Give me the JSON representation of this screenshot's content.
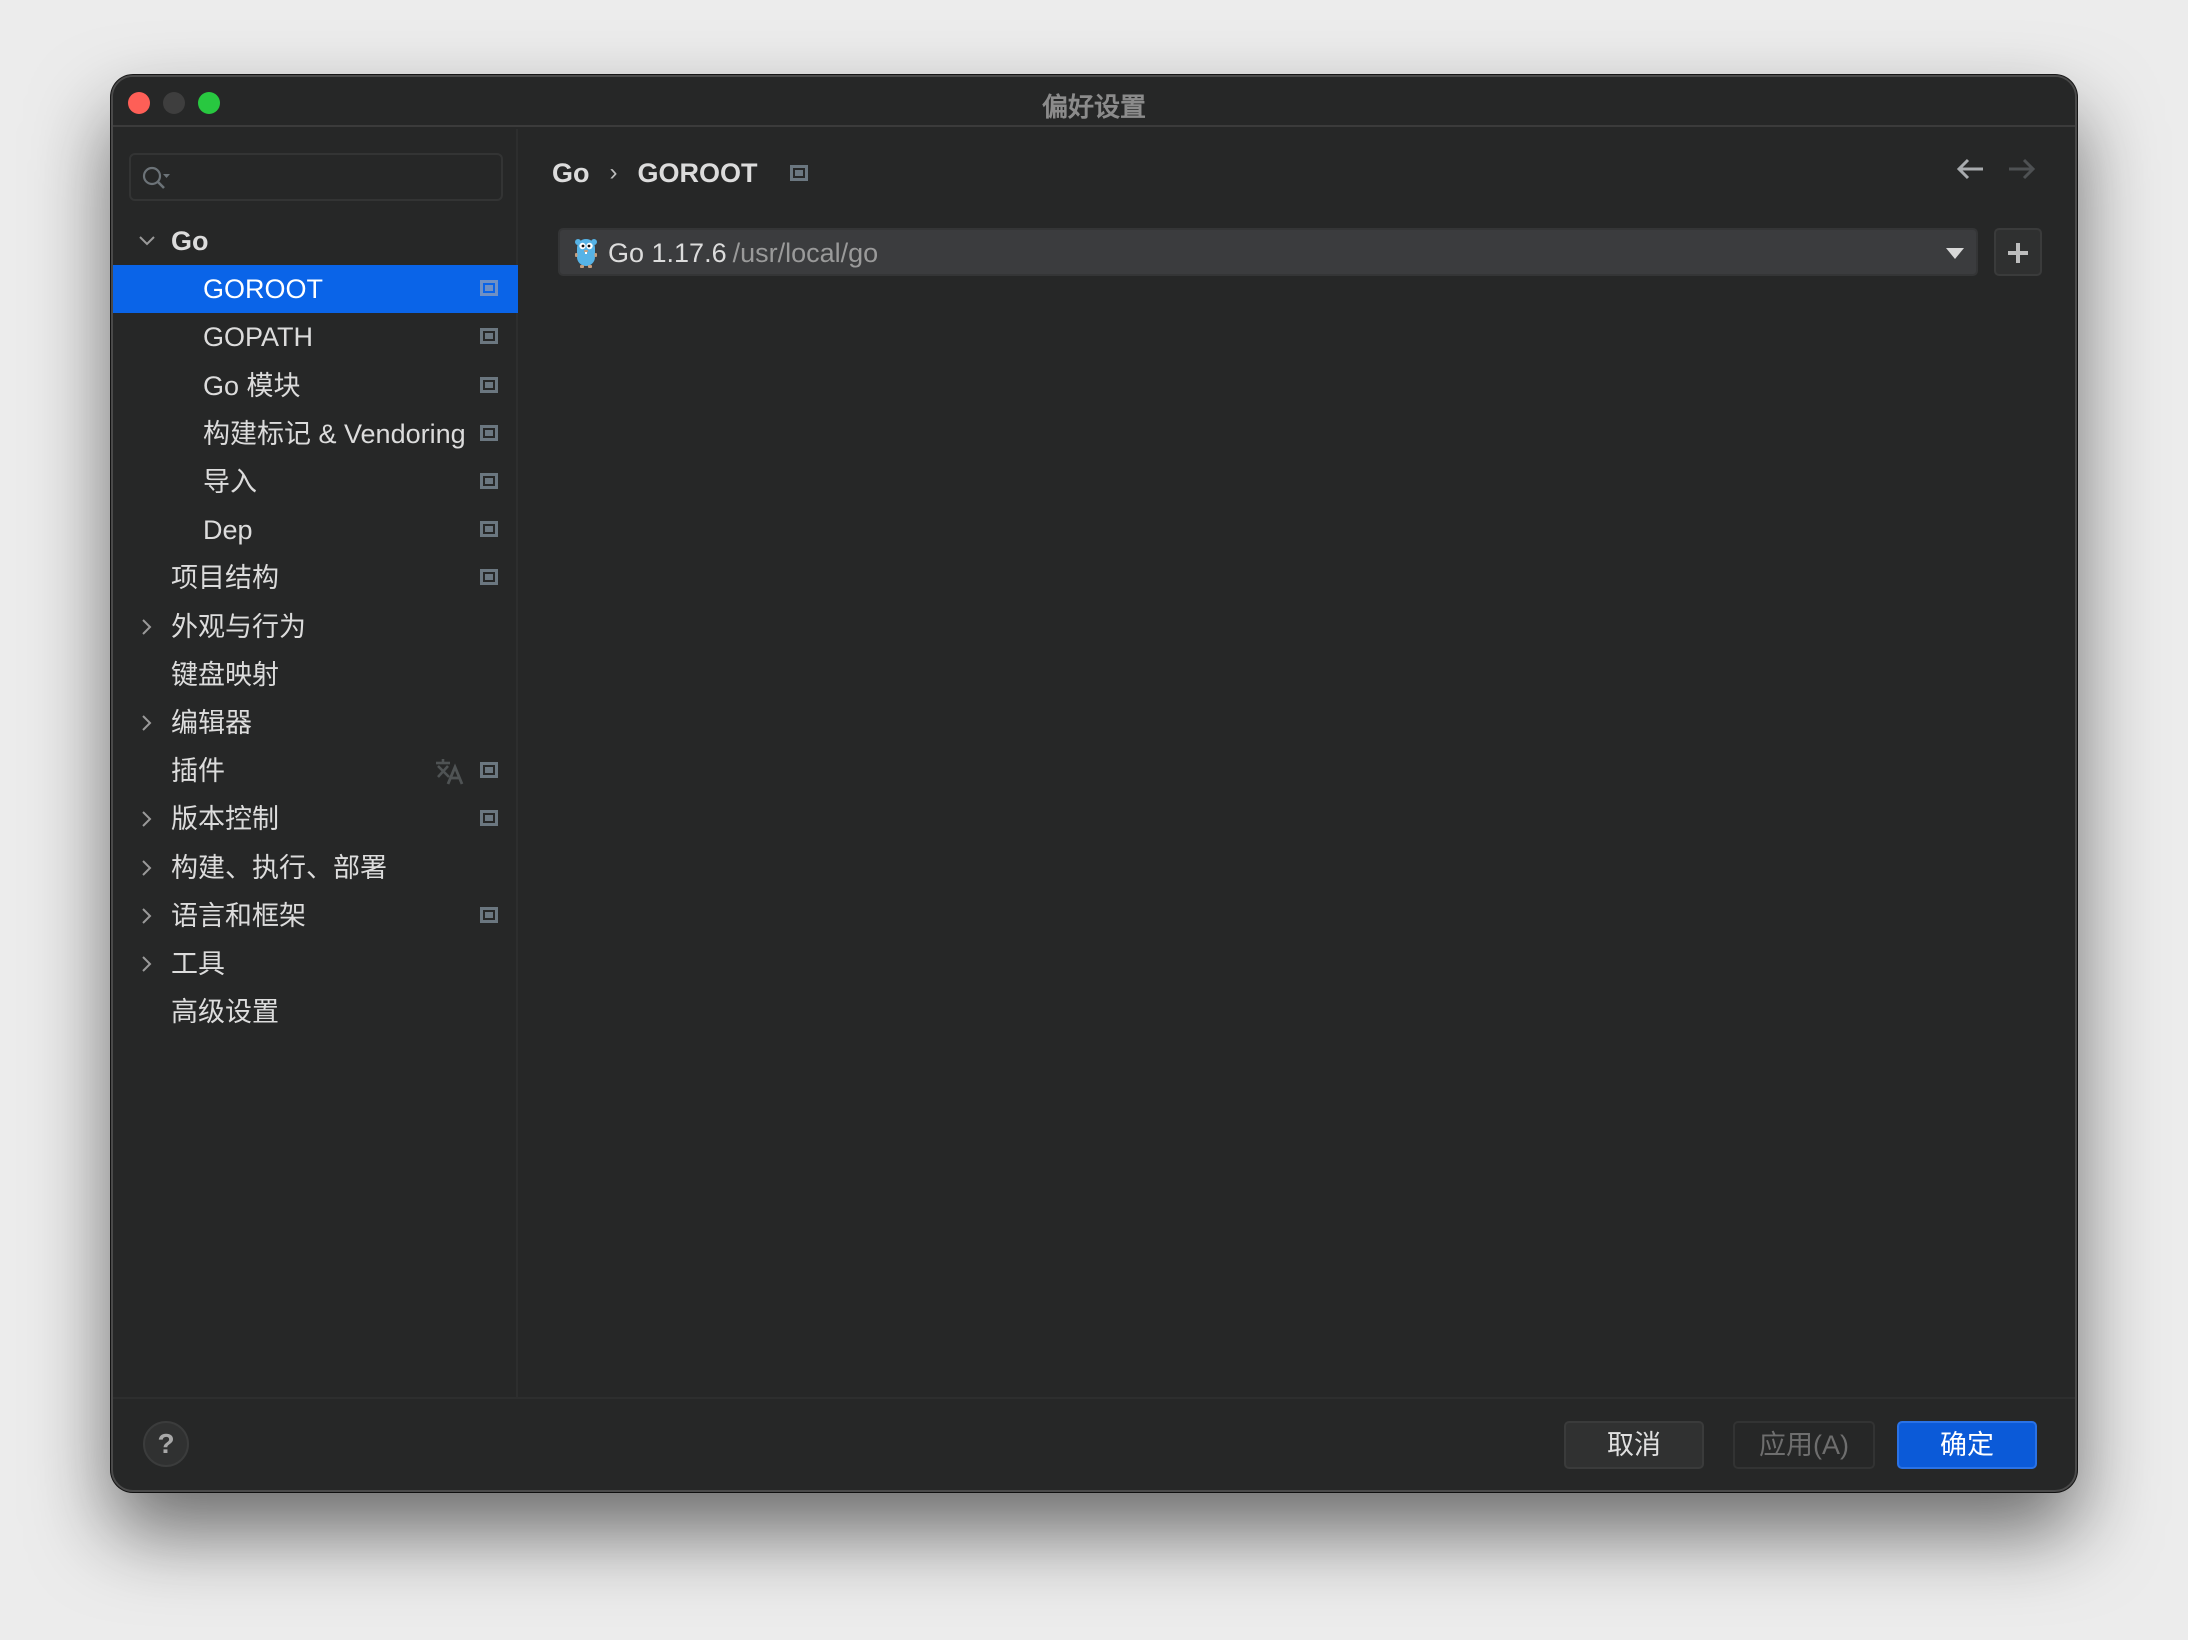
{
  "window": {
    "title": "偏好设置"
  },
  "search": {
    "placeholder": ""
  },
  "sidebar": {
    "items": [
      {
        "label": "Go",
        "level": 0,
        "expandable": true,
        "expanded": true,
        "bold": true
      },
      {
        "label": "GOROOT",
        "level": 1,
        "selected": true,
        "project_icon": true
      },
      {
        "label": "GOPATH",
        "level": 1,
        "project_icon": true
      },
      {
        "label": "Go 模块",
        "level": 1,
        "project_icon": true
      },
      {
        "label": "构建标记 & Vendoring",
        "level": 1,
        "project_icon": true
      },
      {
        "label": "导入",
        "level": 1,
        "project_icon": true
      },
      {
        "label": "Dep",
        "level": 1,
        "project_icon": true
      },
      {
        "label": "项目结构",
        "level": 0,
        "project_icon": true
      },
      {
        "label": "外观与行为",
        "level": 0,
        "expandable": true
      },
      {
        "label": "键盘映射",
        "level": 0
      },
      {
        "label": "编辑器",
        "level": 0,
        "expandable": true
      },
      {
        "label": "插件",
        "level": 0,
        "translate_icon": true,
        "project_icon": true
      },
      {
        "label": "版本控制",
        "level": 0,
        "expandable": true,
        "project_icon": true
      },
      {
        "label": "构建、执行、部署",
        "level": 0,
        "expandable": true
      },
      {
        "label": "语言和框架",
        "level": 0,
        "expandable": true,
        "project_icon": true
      },
      {
        "label": "工具",
        "level": 0,
        "expandable": true
      },
      {
        "label": "高级设置",
        "level": 0
      }
    ]
  },
  "breadcrumb": {
    "parent": "Go",
    "separator": "›",
    "current": "GOROOT"
  },
  "goroot": {
    "sdk_name": "Go 1.17.6",
    "sdk_path": "/usr/local/go"
  },
  "footer": {
    "help_label": "?",
    "cancel_label": "取消",
    "apply_label": "应用(A)",
    "ok_label": "确定"
  },
  "colors": {
    "accent": "#0a64e8",
    "ok_button": "#0b5ad8",
    "background": "#262727"
  }
}
